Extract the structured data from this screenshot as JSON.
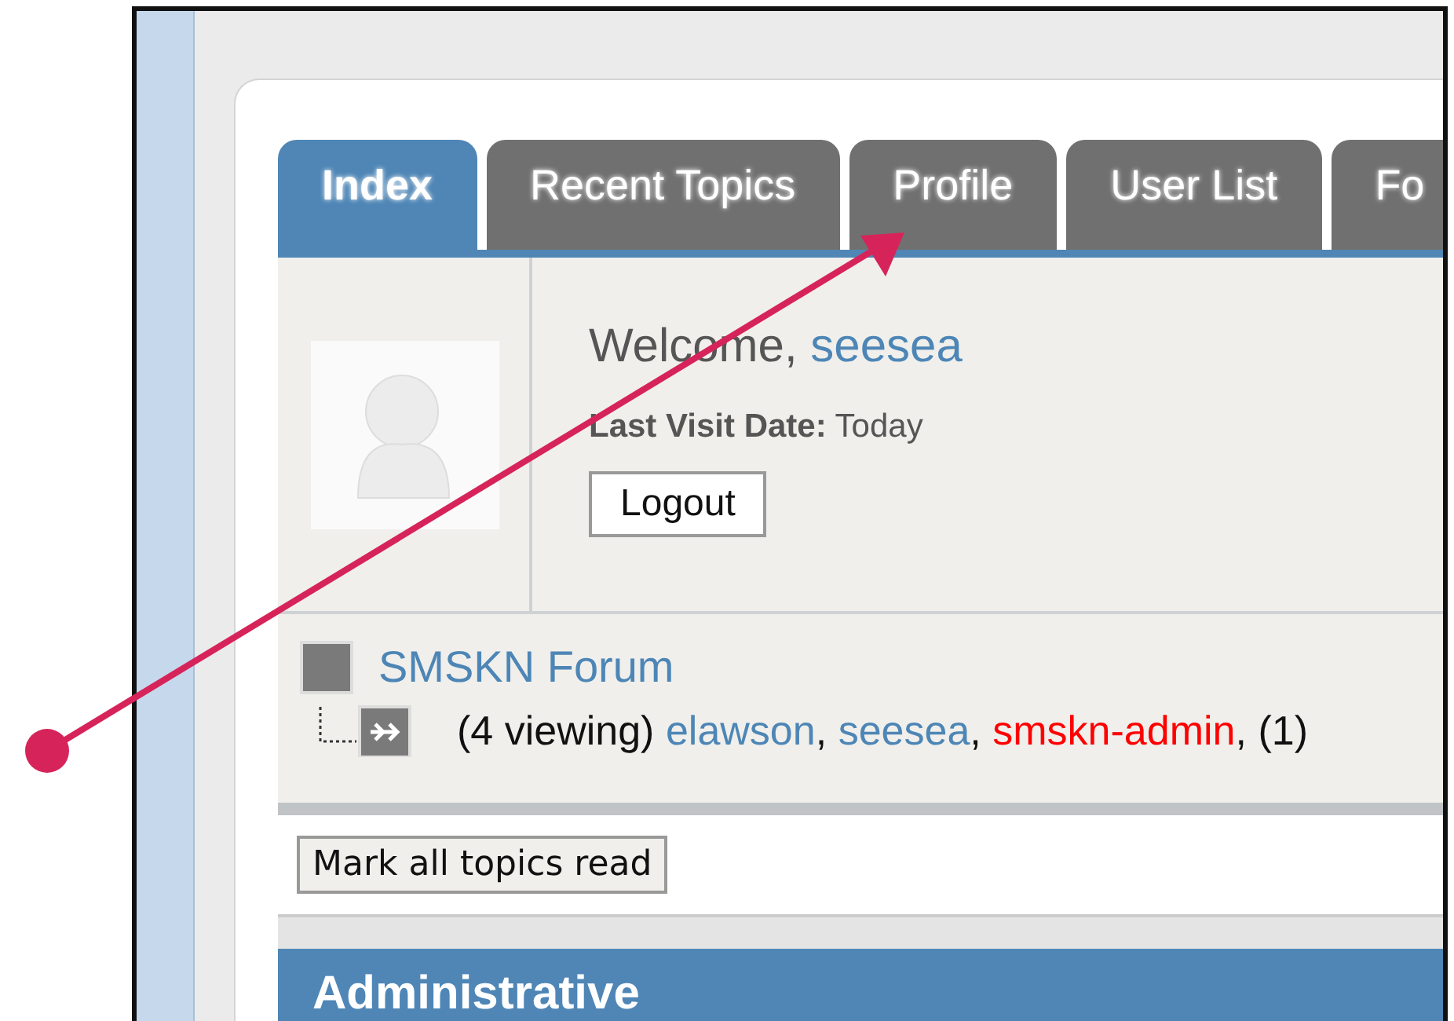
{
  "tabs": [
    {
      "label": "Index",
      "selected": true
    },
    {
      "label": "Recent Topics",
      "selected": false
    },
    {
      "label": "Profile",
      "selected": false
    },
    {
      "label": "User List",
      "selected": false
    },
    {
      "label": "Fo",
      "selected": false
    }
  ],
  "user_panel": {
    "welcome": "Welcome,",
    "username": "seesea",
    "last_visit_label": "Last Visit Date:",
    "last_visit_value": "Today",
    "logout_button": "Logout"
  },
  "forum": {
    "title": "SMSKN Forum",
    "viewing": "(4 viewing)",
    "separator": ",",
    "users": [
      {
        "name": "elawson",
        "color": "#4d86b6"
      },
      {
        "name": "seesea",
        "color": "#4d86b6"
      },
      {
        "name": "smskn-admin",
        "color": "#ff0000"
      }
    ],
    "guests": "(1)"
  },
  "mark_read_button": "Mark all topics read",
  "section_header": "Administrative"
}
